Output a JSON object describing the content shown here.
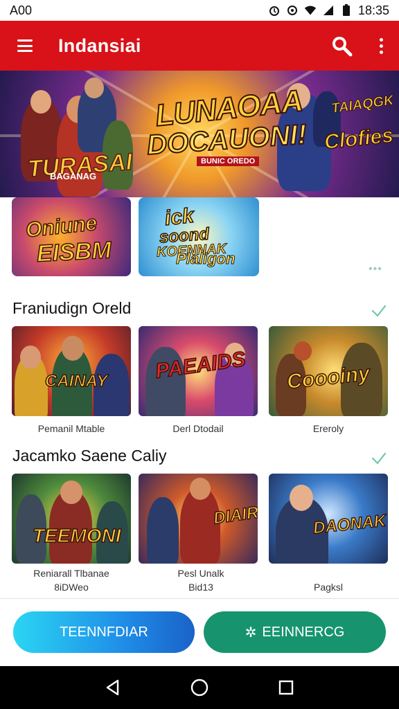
{
  "status_bar": {
    "time_left": "A00",
    "time_right": "18:35"
  },
  "app_bar": {
    "title": "Indansiai"
  },
  "hero": {
    "title_left": "TURASAI",
    "sub_left": "BAGANAG",
    "title_mid_1": "LUNAOAA",
    "title_mid_2": "DOCAUONI!",
    "tag_mid": "BUNIC OREDO",
    "title_right_1": "TAIAQGK",
    "title_right_2": "Clofies"
  },
  "promos": [
    {
      "line1": "Oniune",
      "line2": "EISBM"
    },
    {
      "line1": "ick",
      "line2": "soond",
      "line3": "KOENNAK",
      "line4": "Plaligon"
    }
  ],
  "promo_dots": "•••",
  "sections": [
    {
      "title": "Franiudign Oreld",
      "games": [
        {
          "art_text": "CAINAY",
          "label": "Pemanil Mtable"
        },
        {
          "art_text": "PAEAIDS",
          "label": "Derl Dtodail"
        },
        {
          "art_text": "Coooiny",
          "label": "Ereroly"
        }
      ]
    },
    {
      "title": "Jacamko Saene Caliy",
      "games": [
        {
          "art_text": "TEEMONI",
          "label": "Reniarall Tlbanae",
          "label2": "8iDWeo"
        },
        {
          "art_text": "DIAIRL",
          "label": "Pesl Unalk",
          "label2": "Bid13"
        },
        {
          "art_text": "DAONAK",
          "label": "Pagksl"
        }
      ]
    }
  ],
  "buttons": {
    "left": "TEENNFDIAR",
    "right": "EEINNERCG"
  },
  "colors": {
    "app_bar": "#d81218",
    "button_left": "#1f8ee8",
    "button_right": "#17946e",
    "check": "#6cc7a7"
  }
}
